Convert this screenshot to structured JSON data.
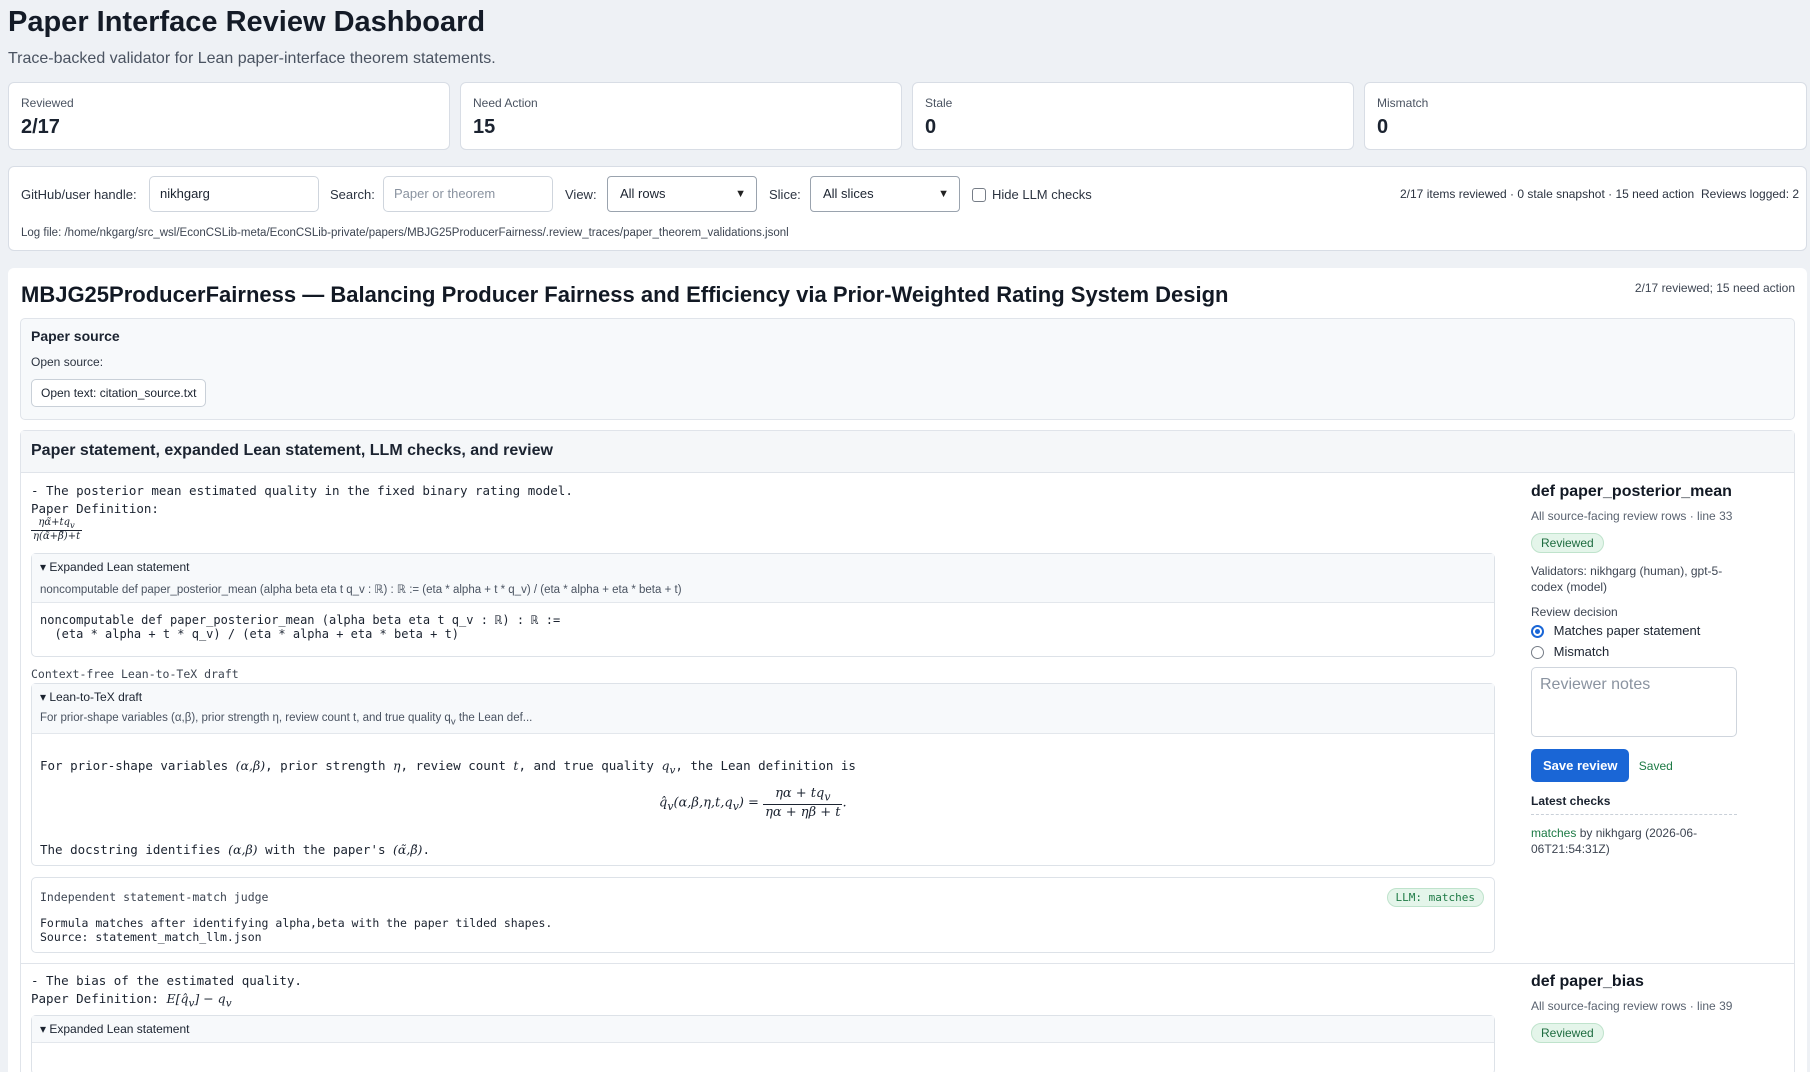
{
  "header": {
    "title": "Paper Interface Review Dashboard",
    "subtitle": "Trace-backed validator for Lean paper-interface theorem statements."
  },
  "stats": [
    {
      "label": "Reviewed",
      "value": "2/17"
    },
    {
      "label": "Need Action",
      "value": "15"
    },
    {
      "label": "Stale",
      "value": "0"
    },
    {
      "label": "Mismatch",
      "value": "0"
    }
  ],
  "controls": {
    "handle_label": "GitHub/user handle:",
    "handle_value": "nikhgarg",
    "search_label": "Search:",
    "search_placeholder": "Paper or theorem",
    "view_label": "View:",
    "view_value": "All rows",
    "slice_label": "Slice:",
    "slice_value": "All slices",
    "hide_llm_label": "Hide LLM checks",
    "summary": "2/17 items reviewed · 0 stale snapshot · 15 need action",
    "reviews_logged": "Reviews logged: 2",
    "log_file": "Log file: /home/nkgarg/src_wsl/EconCSLib-meta/EconCSLib-private/papers/MBJG25ProducerFairness/.review_traces/paper_theorem_validations.jsonl"
  },
  "paper": {
    "title": "MBJG25ProducerFairness — Balancing Producer Fairness and Efficiency via Prior-Weighted Rating System Design",
    "progress": "2/17 reviewed; 15 need action",
    "source_heading": "Paper source",
    "open_source_label": "Open source:",
    "open_text_button": "Open text: citation_source.txt",
    "section_heading": "Paper statement, expanded Lean statement, LLM checks, and review"
  },
  "rows": [
    {
      "description": "- The posterior mean estimated quality in the fixed binary rating model.",
      "definition_label": "Paper Definition:",
      "paper_formula_num": "ηα̃+tq",
      "paper_formula_num_sub": "v",
      "paper_formula_den": "η(α̃+β̃)+t",
      "expanded_label": "▾ Expanded Lean statement",
      "expanded_summary": "noncomputable def paper_posterior_mean (alpha beta eta t q_v : ℝ) : ℝ := (eta * alpha + t * q_v) / (eta * alpha + eta * beta + t)",
      "lean_code": "noncomputable def paper_posterior_mean (alpha beta eta t q_v : ℝ) : ℝ :=\n  (eta * alpha + t * q_v) / (eta * alpha + eta * beta + t)",
      "draft_caption": "Context-free Lean-to-TeX draft",
      "draft_label": "▾ Lean-to-TeX draft",
      "draft_summary": "For prior-shape variables (α,β), prior strength η, review count t, and true quality q",
      "draft_summary_sub": "v",
      "draft_summary_tail": " the Lean def...",
      "draft_body_a": "For prior-shape variables ",
      "draft_body_b": "(α,β)",
      "draft_body_c": ", prior strength ",
      "draft_body_d": "η",
      "draft_body_e": ", review count ",
      "draft_body_f": "t",
      "draft_body_g": ", and true quality ",
      "draft_body_h": "q",
      "draft_body_h_sub": "v",
      "draft_body_i": ", the Lean definition is",
      "eq_lhs": "q̂",
      "eq_lhs_sub": "v",
      "eq_lhs_args": "(α,β,η,t,q",
      "eq_lhs_args_sub": "v",
      "eq_lhs_close": ") =",
      "eq_num": "ηα + tq",
      "eq_num_sub": "v",
      "eq_den": "ηα + ηβ + t",
      "eq_dot": ".",
      "docstring_a": "The docstring identifies ",
      "docstring_b": "(α,β)",
      "docstring_c": " with the paper's ",
      "docstring_d": "(α̃,β̃)",
      "docstring_e": ".",
      "judge_caption": "Independent statement-match judge",
      "judge_badge": "LLM: matches",
      "judge_text": "Formula matches after identifying alpha,beta with the paper tilded shapes.\nSource: statement_match_llm.json",
      "side": {
        "def_name": "def paper_posterior_mean",
        "meta": "All source-facing review rows · line 33",
        "status": "Reviewed",
        "validators": "Validators: nikhgarg (human), gpt-5-codex (model)",
        "decision_label": "Review decision",
        "option_match": "Matches paper statement",
        "option_mismatch": "Mismatch",
        "notes_placeholder": "Reviewer notes",
        "save_button": "Save review",
        "saved_text": "Saved",
        "latest_heading": "Latest checks",
        "latest_match": "matches",
        "latest_detail": " by nikhgarg (2026-06-06T21:54:31Z)"
      }
    },
    {
      "description": "- The bias of the estimated quality.",
      "definition_label": "Paper Definition:",
      "paper_formula_a": "E[q̂",
      "paper_formula_a_sub": "v",
      "paper_formula_b": "] − q",
      "paper_formula_b_sub": "v",
      "expanded_label": "▾ Expanded Lean statement",
      "side": {
        "def_name": "def paper_bias",
        "meta": "All source-facing review rows · line 39",
        "status": "Reviewed"
      }
    }
  ],
  "colors": {
    "accent": "#1a66d6",
    "success": "#1d7a45",
    "page_bg": "#eef1f5"
  }
}
